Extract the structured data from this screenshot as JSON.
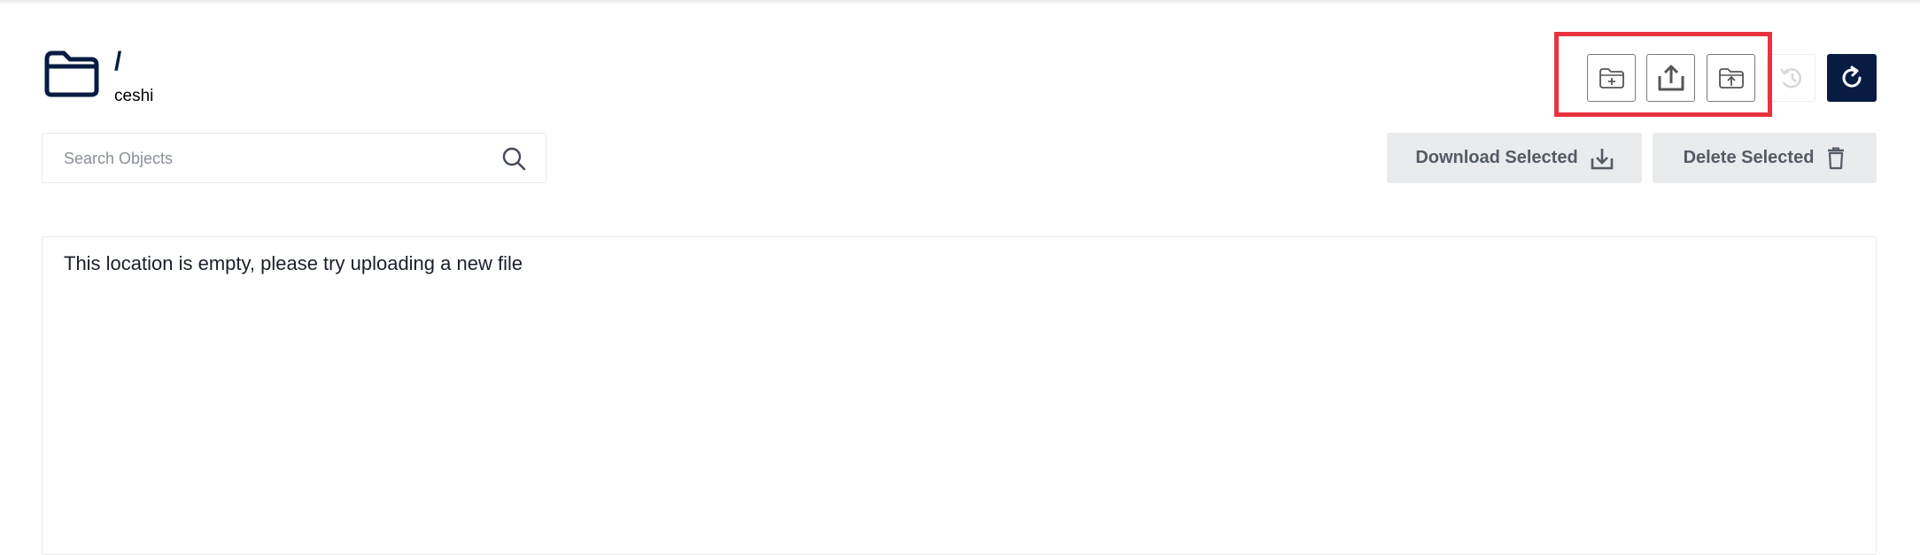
{
  "header": {
    "path": "/",
    "bucket": "ceshi"
  },
  "toolbar": {
    "buttons": [
      {
        "name": "create-folder",
        "icon": "folder-plus-icon"
      },
      {
        "name": "upload-file",
        "icon": "upload-icon"
      },
      {
        "name": "upload-folder",
        "icon": "folder-upload-icon"
      },
      {
        "name": "rewind",
        "icon": "history-icon",
        "disabled": true
      },
      {
        "name": "refresh",
        "icon": "refresh-icon"
      }
    ],
    "highlight_color": "#e8333e"
  },
  "search": {
    "placeholder": "Search Objects",
    "value": ""
  },
  "actions": {
    "download_label": "Download Selected",
    "delete_label": "Delete Selected"
  },
  "content": {
    "empty_message": "This location is empty, please try uploading a new file"
  },
  "colors": {
    "primary": "#081c42",
    "action_bg": "#e9ebed",
    "action_text": "#555b66"
  }
}
